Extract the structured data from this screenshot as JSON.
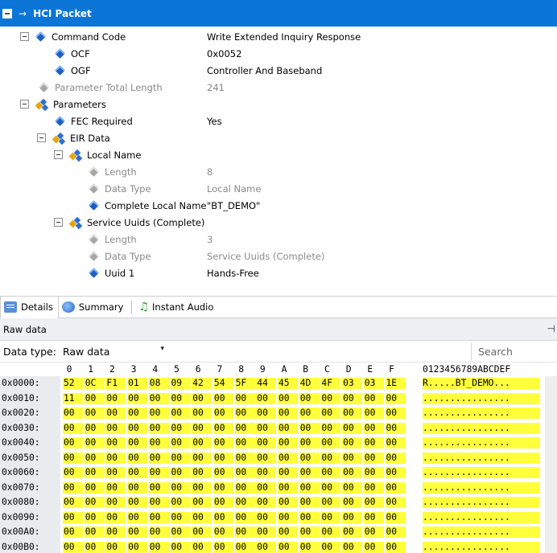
{
  "tree": {
    "header_arrow": "→",
    "header_title": "HCI Packet",
    "rows": [
      {
        "name": "Command Code",
        "value": "Write Extended Inquiry Response"
      },
      {
        "name": "OCF",
        "value": "0x0052"
      },
      {
        "name": "OGF",
        "value": "Controller And Baseband"
      },
      {
        "name": "Parameter Total Length",
        "value": "241"
      },
      {
        "name": "Parameters",
        "value": ""
      },
      {
        "name": "FEC Required",
        "value": "Yes"
      },
      {
        "name": "EIR Data",
        "value": ""
      },
      {
        "name": "Local Name",
        "value": ""
      },
      {
        "name": "Length",
        "value": "8"
      },
      {
        "name": "Data Type",
        "value": "Local Name"
      },
      {
        "name": "Complete Local Name",
        "value": "\"BT_DEMO\""
      },
      {
        "name": "Service Uuids (Complete)",
        "value": ""
      },
      {
        "name": "Length",
        "value": "3"
      },
      {
        "name": "Data Type",
        "value": "Service Uuids (Complete)"
      },
      {
        "name": "Uuid 1",
        "value": "Hands-Free"
      }
    ]
  },
  "tabs": {
    "details": "Details",
    "summary": "Summary",
    "instant_audio": "Instant Audio"
  },
  "raw": {
    "title": "Raw data",
    "pin": "⎕",
    "data_type_label": "Data type:",
    "data_type_value": "Raw data",
    "search_placeholder": "Search",
    "column_headers": [
      "0",
      "1",
      "2",
      "3",
      "4",
      "5",
      "6",
      "7",
      "8",
      "9",
      "A",
      "B",
      "C",
      "D",
      "E",
      "F"
    ],
    "ascii_header": "0123456789ABCDEF",
    "rows": [
      {
        "addr": "0x0000:",
        "bytes": [
          "52",
          "0C",
          "F1",
          "01",
          "08",
          "09",
          "42",
          "54",
          "5F",
          "44",
          "45",
          "4D",
          "4F",
          "03",
          "03",
          "1E"
        ],
        "ascii": "R.....BT_DEMO..."
      },
      {
        "addr": "0x0010:",
        "bytes": [
          "11",
          "00",
          "00",
          "00",
          "00",
          "00",
          "00",
          "00",
          "00",
          "00",
          "00",
          "00",
          "00",
          "00",
          "00",
          "00"
        ],
        "ascii": "................"
      },
      {
        "addr": "0x0020:",
        "bytes": [
          "00",
          "00",
          "00",
          "00",
          "00",
          "00",
          "00",
          "00",
          "00",
          "00",
          "00",
          "00",
          "00",
          "00",
          "00",
          "00"
        ],
        "ascii": "................"
      },
      {
        "addr": "0x0030:",
        "bytes": [
          "00",
          "00",
          "00",
          "00",
          "00",
          "00",
          "00",
          "00",
          "00",
          "00",
          "00",
          "00",
          "00",
          "00",
          "00",
          "00"
        ],
        "ascii": "................"
      },
      {
        "addr": "0x0040:",
        "bytes": [
          "00",
          "00",
          "00",
          "00",
          "00",
          "00",
          "00",
          "00",
          "00",
          "00",
          "00",
          "00",
          "00",
          "00",
          "00",
          "00"
        ],
        "ascii": "................"
      },
      {
        "addr": "0x0050:",
        "bytes": [
          "00",
          "00",
          "00",
          "00",
          "00",
          "00",
          "00",
          "00",
          "00",
          "00",
          "00",
          "00",
          "00",
          "00",
          "00",
          "00"
        ],
        "ascii": "................"
      },
      {
        "addr": "0x0060:",
        "bytes": [
          "00",
          "00",
          "00",
          "00",
          "00",
          "00",
          "00",
          "00",
          "00",
          "00",
          "00",
          "00",
          "00",
          "00",
          "00",
          "00"
        ],
        "ascii": "................"
      },
      {
        "addr": "0x0070:",
        "bytes": [
          "00",
          "00",
          "00",
          "00",
          "00",
          "00",
          "00",
          "00",
          "00",
          "00",
          "00",
          "00",
          "00",
          "00",
          "00",
          "00"
        ],
        "ascii": "................"
      },
      {
        "addr": "0x0080:",
        "bytes": [
          "00",
          "00",
          "00",
          "00",
          "00",
          "00",
          "00",
          "00",
          "00",
          "00",
          "00",
          "00",
          "00",
          "00",
          "00",
          "00"
        ],
        "ascii": "................"
      },
      {
        "addr": "0x0090:",
        "bytes": [
          "00",
          "00",
          "00",
          "00",
          "00",
          "00",
          "00",
          "00",
          "00",
          "00",
          "00",
          "00",
          "00",
          "00",
          "00",
          "00"
        ],
        "ascii": "................"
      },
      {
        "addr": "0x00A0:",
        "bytes": [
          "00",
          "00",
          "00",
          "00",
          "00",
          "00",
          "00",
          "00",
          "00",
          "00",
          "00",
          "00",
          "00",
          "00",
          "00",
          "00"
        ],
        "ascii": "................"
      },
      {
        "addr": "0x00B0:",
        "bytes": [
          "00",
          "00",
          "00",
          "00",
          "00",
          "00",
          "00",
          "00",
          "00",
          "00",
          "00",
          "00",
          "00",
          "00",
          "00",
          "00"
        ],
        "ascii": "................"
      }
    ]
  },
  "colors": {
    "header_blue": "#0b76d8",
    "hex_highlight": "#ffff3b",
    "address_background": "#e9ebee"
  }
}
